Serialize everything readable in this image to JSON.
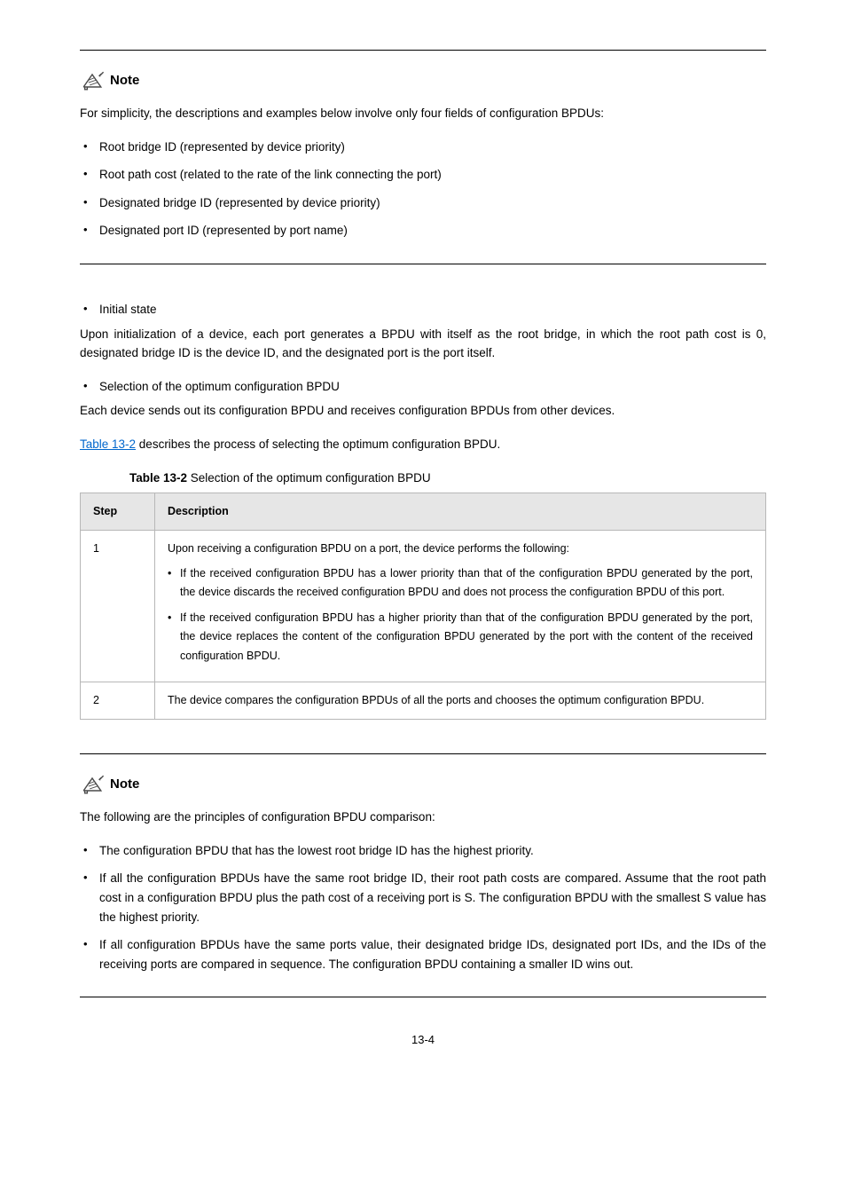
{
  "note1": {
    "label": "Note",
    "intro": "For simplicity, the descriptions and examples below involve only four fields of configuration BPDUs:",
    "items": [
      "Root bridge ID (represented by device priority)",
      "Root path cost (related to the rate of the link connecting the port)",
      "Designated bridge ID (represented by device priority)",
      "Designated port ID (represented by port name)"
    ]
  },
  "section1": {
    "bullet1": "Initial state",
    "p1": "Upon initialization of a device, each port generates a BPDU with itself as the root bridge, in which the root path cost is 0, designated bridge ID is the device ID, and the designated port is the port itself.",
    "bullet2": "Selection of the optimum configuration BPDU",
    "p2_a": "Each device sends out its configuration BPDU and receives configuration BPDUs from other devices.",
    "p2_link": "Table 13-2",
    "p2_b": " describes the process of selecting the optimum configuration BPDU."
  },
  "table": {
    "caption_prefix": "Table 13-2 ",
    "caption": "Selection of the optimum configuration BPDU",
    "h1": "Step",
    "h2": "Description",
    "r1": {
      "step": "1",
      "intro": "Upon receiving a configuration BPDU on a port, the device performs the following:",
      "b1": "If the received configuration BPDU has a lower priority than that of the configuration BPDU generated by the port, the device discards the received configuration BPDU and does not process the configuration BPDU of this port.",
      "b2": "If the received configuration BPDU has a higher priority than that of the configuration BPDU generated by the port, the device replaces the content of the configuration BPDU generated by the port with the content of the received configuration BPDU."
    },
    "r2": {
      "step": "2",
      "desc": "The device compares the configuration BPDUs of all the ports and chooses the optimum configuration BPDU."
    }
  },
  "note2": {
    "label": "Note",
    "intro": "The following are the principles of configuration BPDU comparison:",
    "items": [
      "The configuration BPDU that has the lowest root bridge ID has the highest priority.",
      "If all the configuration BPDUs have the same root bridge ID, their root path costs are compared. Assume that the root path cost in a configuration BPDU plus the path cost of a receiving port is S. The configuration BPDU with the smallest S value has the highest priority.",
      "If all configuration BPDUs have the same ports value, their designated bridge IDs, designated port IDs, and the IDs of the receiving ports are compared in sequence. The configuration BPDU containing a smaller ID wins out."
    ]
  },
  "footer": "13-4"
}
